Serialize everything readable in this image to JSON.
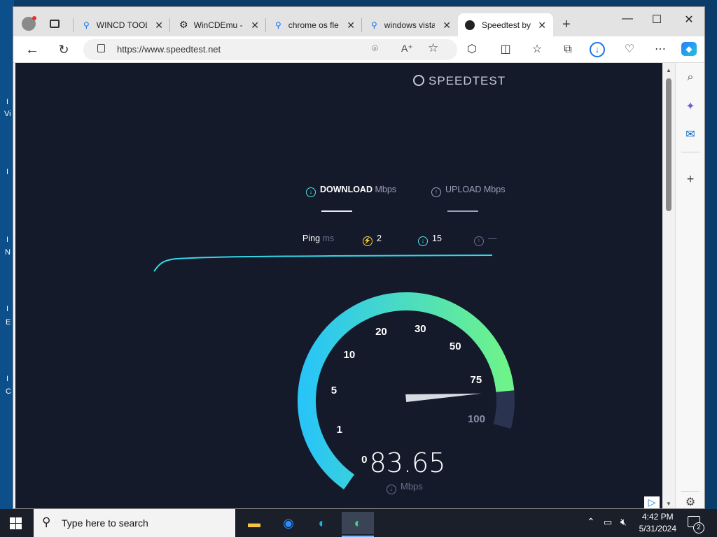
{
  "desktop": {
    "edge_letters": [
      "I",
      "Vi",
      "I",
      "N",
      "I",
      "E",
      "I",
      "C"
    ]
  },
  "browser": {
    "tabs": [
      {
        "title": "WINCD TOOL",
        "icon": "search-icon"
      },
      {
        "title": "WinCDEmu -",
        "icon": "gear-icon"
      },
      {
        "title": "chrome os fle",
        "icon": "search-icon"
      },
      {
        "title": "windows vista",
        "icon": "search-icon"
      },
      {
        "title": "Speedtest by",
        "icon": "speedtest-icon",
        "active": true
      }
    ],
    "new_tab": "+",
    "window_controls": {
      "minimize": "—",
      "maximize": "☐",
      "close": "✕"
    },
    "url": "https://www.speedtest.net"
  },
  "speedtest": {
    "brand": "SPEEDTEST",
    "download_label": "DOWNLOAD",
    "download_unit": "Mbps",
    "upload_label": "UPLOAD",
    "upload_unit": "Mbps",
    "ping_label": "Ping",
    "ping_unit": "ms",
    "ping_value": "2",
    "jitter_down": "15",
    "jitter_up": "—",
    "gauge_labels": [
      "0",
      "1",
      "5",
      "10",
      "20",
      "30",
      "50",
      "75",
      "100"
    ],
    "value": "83.65",
    "value_unit": "Mbps",
    "gauge_value": 83.65
  },
  "taskbar": {
    "search_placeholder": "Type here to search",
    "time": "4:42 PM",
    "date": "5/31/2024",
    "notification_count": "2"
  },
  "colors": {
    "page_bg": "#151a2a",
    "gauge_start": "#29c5f6",
    "gauge_end": "#6df38a",
    "accent_line": "#34d7e8"
  }
}
